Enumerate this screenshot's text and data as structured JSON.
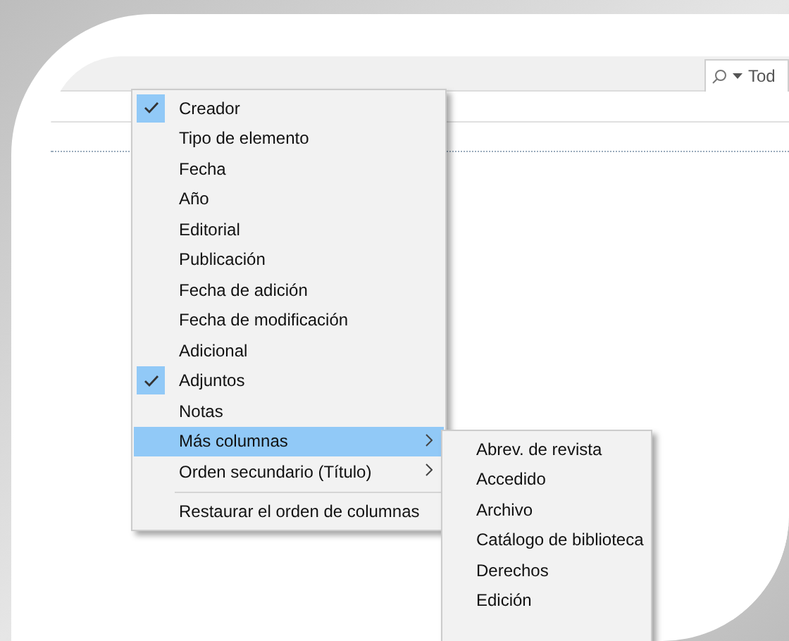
{
  "toolbar": {
    "search": {
      "value": "Tod"
    }
  },
  "context_menu": {
    "items": [
      {
        "kind": "item",
        "label": "Creador",
        "checked": true,
        "selected": false,
        "submenu": false
      },
      {
        "kind": "item",
        "label": "Tipo de elemento",
        "checked": false,
        "selected": false,
        "submenu": false
      },
      {
        "kind": "item",
        "label": "Fecha",
        "checked": false,
        "selected": false,
        "submenu": false
      },
      {
        "kind": "item",
        "label": "Año",
        "checked": false,
        "selected": false,
        "submenu": false
      },
      {
        "kind": "item",
        "label": "Editorial",
        "checked": false,
        "selected": false,
        "submenu": false
      },
      {
        "kind": "item",
        "label": "Publicación",
        "checked": false,
        "selected": false,
        "submenu": false
      },
      {
        "kind": "item",
        "label": "Fecha de adición",
        "checked": false,
        "selected": false,
        "submenu": false
      },
      {
        "kind": "item",
        "label": "Fecha de modificación",
        "checked": false,
        "selected": false,
        "submenu": false
      },
      {
        "kind": "item",
        "label": "Adicional",
        "checked": false,
        "selected": false,
        "submenu": false
      },
      {
        "kind": "item",
        "label": "Adjuntos",
        "checked": true,
        "selected": false,
        "submenu": false
      },
      {
        "kind": "item",
        "label": "Notas",
        "checked": false,
        "selected": false,
        "submenu": false
      },
      {
        "kind": "item",
        "label": "Más columnas",
        "checked": false,
        "selected": true,
        "submenu": true
      },
      {
        "kind": "item",
        "label": "Orden secundario (Título)",
        "checked": false,
        "selected": false,
        "submenu": true
      },
      {
        "kind": "separator"
      },
      {
        "kind": "item",
        "label": "Restaurar el orden de columnas",
        "checked": false,
        "selected": false,
        "submenu": false
      }
    ]
  },
  "submenu": {
    "items": [
      {
        "label": "Abrev. de revista"
      },
      {
        "label": "Accedido"
      },
      {
        "label": "Archivo"
      },
      {
        "label": "Catálogo de biblioteca"
      },
      {
        "label": "Derechos"
      },
      {
        "label": "Edición"
      }
    ]
  }
}
